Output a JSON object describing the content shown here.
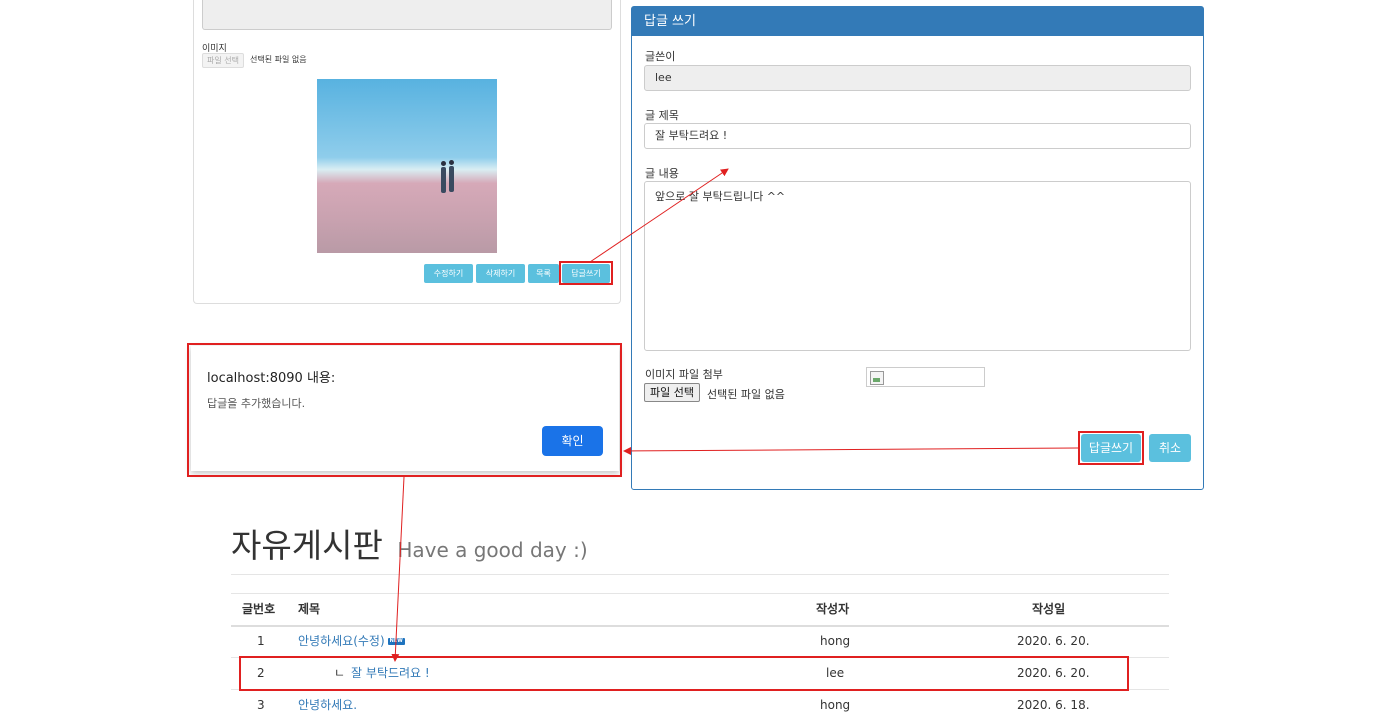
{
  "left_panel": {
    "image_label": "이미지",
    "file_button": "파일 선택",
    "file_status": "선택된 파일 없음",
    "buttons": {
      "edit": "수정하기",
      "delete": "삭제하기",
      "list": "목록",
      "reply": "답글쓰기"
    }
  },
  "reply_form": {
    "header": "답글 쓰기",
    "writer_label": "글쓴이",
    "writer_value": "lee",
    "title_label": "글 제목",
    "title_value": "잘 부탁드려요 !",
    "content_label": "글 내용",
    "content_value": "앞으로 잘 부탁드립니다 ^^",
    "attach_label": "이미지 파일 첨부",
    "file_button": "파일 선택",
    "file_status": "선택된 파일 없음",
    "submit_label": "답글쓰기",
    "cancel_label": "취소"
  },
  "dialog": {
    "title": "localhost:8090 내용:",
    "message": "답글을 추가했습니다.",
    "ok_label": "확인"
  },
  "board": {
    "title": "자유게시판",
    "subtitle": "Have a good day :)",
    "columns": {
      "no": "글번호",
      "title": "제목",
      "writer": "작성자",
      "date": "작성일"
    },
    "rows": [
      {
        "no": "1",
        "prefix": "",
        "title": "안녕하세요(수정)",
        "badge": "NEW",
        "writer": "hong",
        "date": "2020. 6. 20."
      },
      {
        "no": "2",
        "prefix": "ㄴ",
        "title": "잘 부탁드려요 !",
        "badge": "",
        "writer": "lee",
        "date": "2020. 6. 20."
      },
      {
        "no": "3",
        "prefix": "",
        "title": "안녕하세요.",
        "badge": "",
        "writer": "hong",
        "date": "2020. 6. 18."
      }
    ]
  },
  "colors": {
    "primary": "#337ab7",
    "info": "#5bc0de",
    "dialog_button": "#1a73e8",
    "annotation_red": "#e02020"
  }
}
